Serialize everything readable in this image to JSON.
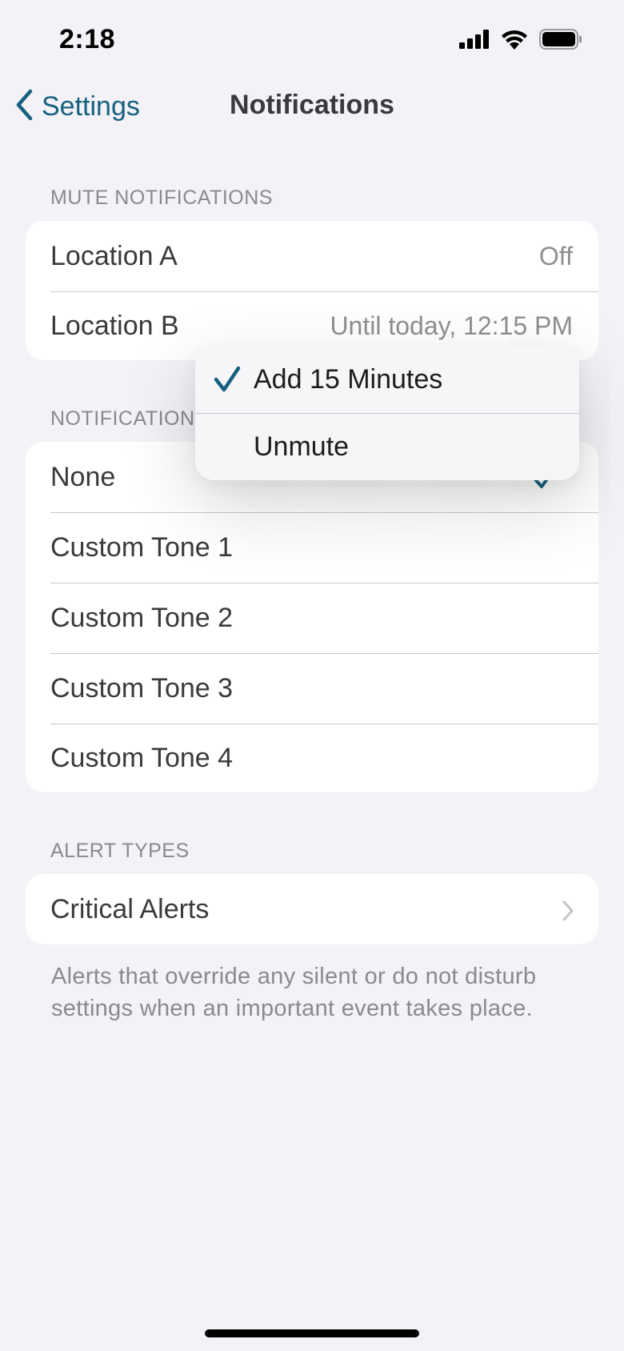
{
  "status_bar": {
    "time": "2:18",
    "icons": [
      "cellular-signal-icon",
      "wifi-icon",
      "battery-icon"
    ]
  },
  "nav": {
    "back_label": "Settings",
    "title": "Notifications"
  },
  "mute_section": {
    "header": "MUTE NOTIFICATIONS",
    "rows": [
      {
        "label": "Location A",
        "value": "Off"
      },
      {
        "label": "Location B",
        "value": "Until today, 12:15 PM"
      }
    ]
  },
  "tone_section": {
    "header": "NOTIFICATION",
    "rows": [
      {
        "label": "None",
        "selected": true
      },
      {
        "label": "Custom Tone 1"
      },
      {
        "label": "Custom Tone 2"
      },
      {
        "label": "Custom Tone 3"
      },
      {
        "label": "Custom Tone 4"
      }
    ]
  },
  "alert_section": {
    "header": "ALERT TYPES",
    "rows": [
      {
        "label": "Critical Alerts"
      }
    ],
    "footer": "Alerts that override any silent or do not disturb settings when an important event takes place."
  },
  "context_menu": {
    "items": [
      {
        "label": "Add 15 Minutes",
        "checked": true
      },
      {
        "label": "Unmute",
        "checked": false
      }
    ]
  },
  "colors": {
    "accent": "#17607f",
    "background": "#f2f2f7",
    "secondary_text": "#8e8e93"
  }
}
